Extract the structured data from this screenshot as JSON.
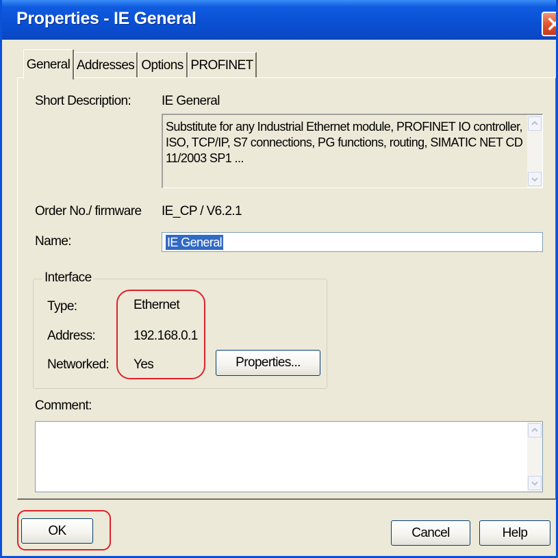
{
  "window": {
    "title": "Properties - IE General"
  },
  "tabs": [
    {
      "label": "General",
      "active": true
    },
    {
      "label": "Addresses",
      "active": false
    },
    {
      "label": "Options",
      "active": false
    },
    {
      "label": "PROFINET",
      "active": false
    }
  ],
  "general": {
    "short_description_label": "Short Description:",
    "short_description_value": "IE General",
    "description_text": "Substitute for any Industrial Ethernet module, PROFINET IO controller, ISO, TCP/IP, S7 connections, PG functions, routing, SIMATIC NET CD 11/2003 SP1 ...",
    "order_label": "Order No./ firmware",
    "order_value": "IE_CP / V6.2.1",
    "name_label": "Name:",
    "name_value": "IE General"
  },
  "interface": {
    "legend": "Interface",
    "type_label": "Type:",
    "type_value": "Ethernet",
    "address_label": "Address:",
    "address_value": "192.168.0.1",
    "networked_label": "Networked:",
    "networked_value": "Yes",
    "properties_button": "Properties..."
  },
  "comment": {
    "label": "Comment:",
    "value": ""
  },
  "footer": {
    "ok_label": "OK",
    "cancel_label": "Cancel",
    "help_label": "Help"
  },
  "icons": {
    "close": "close-icon",
    "scroll_up": "scroll-up-arrow-icon",
    "scroll_down": "scroll-down-arrow-icon"
  },
  "colors": {
    "titlebar": "#0a4fd3",
    "dialog_bg": "#ece9d8",
    "selection": "#316ac5",
    "annotation": "#e0202a"
  }
}
